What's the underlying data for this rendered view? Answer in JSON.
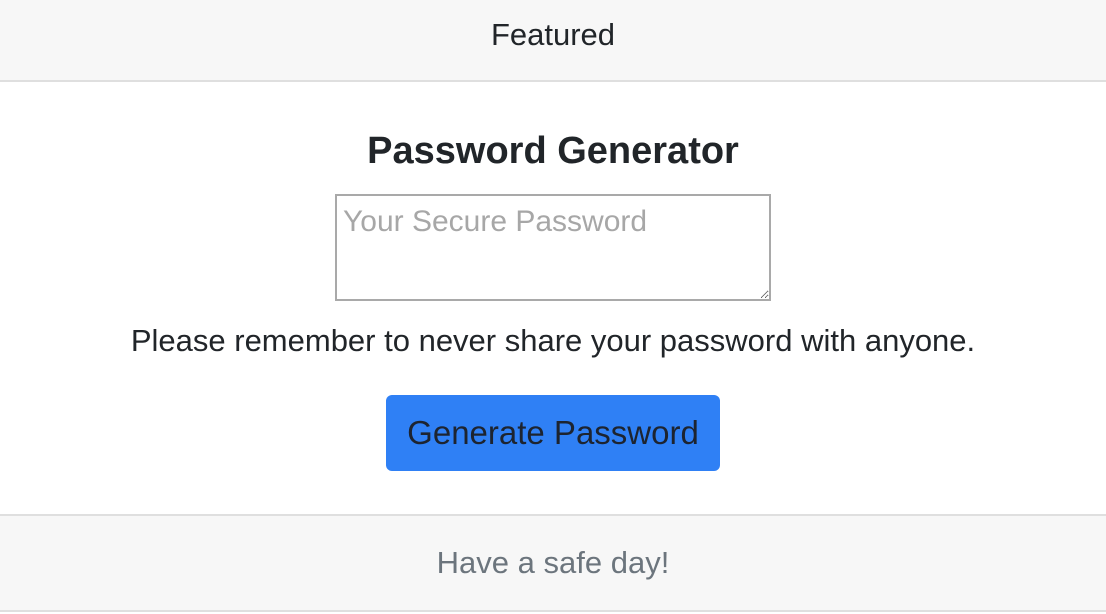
{
  "header": {
    "title": "Featured"
  },
  "main": {
    "heading": "Password Generator",
    "password_field": {
      "value": "",
      "placeholder": "Your Secure Password"
    },
    "notice": "Please remember to never share your password with anyone.",
    "generate_button_label": "Generate Password"
  },
  "footer": {
    "message": "Have a safe day!"
  },
  "colors": {
    "button_bg": "#2f80f5",
    "header_bg": "#f7f7f7",
    "footer_text": "#6c757d"
  }
}
